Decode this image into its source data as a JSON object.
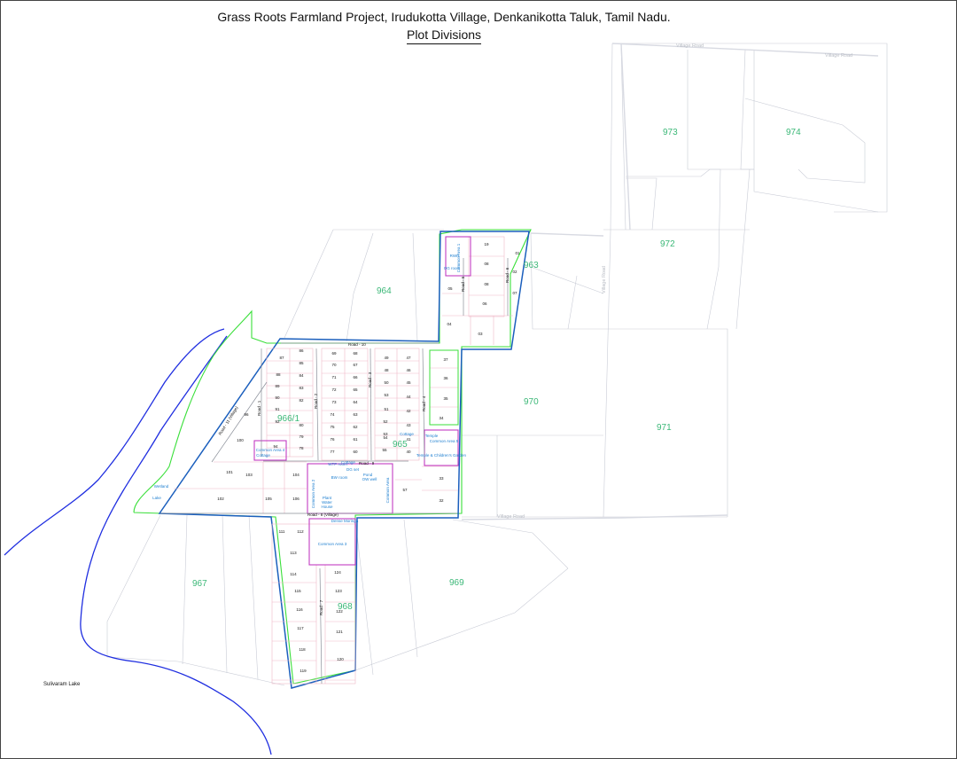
{
  "title": {
    "line1": "Grass Roots Farmland Project, Irudukotta Village, Denkanikotta Taluk, Tamil Nadu.",
    "line2": "Plot Divisions"
  },
  "colors": {
    "survey_label": "#3cb878",
    "project_boundary": "#1b5fbd",
    "outer_boundary": "#3adf3a",
    "common_area": "#c23cc2",
    "plot_lines": "#f0b8c8",
    "lake_shore": "#1f2ee0",
    "survey_lines": "#c9ccd6"
  },
  "survey_numbers": [
    "973",
    "974",
    "972",
    "963",
    "964",
    "966/1",
    "965",
    "970",
    "971",
    "967",
    "968",
    "969"
  ],
  "roads": {
    "road_10": "Road - 10",
    "road_9": "Road - 9",
    "road_8": "Road - 8 (Village)",
    "road_1": "Road - 1",
    "road_2": "Road - 2",
    "road_3": "Road - 3",
    "road_4": "Road - 4",
    "road_5": "Road - 5",
    "road_6": "Road - 6",
    "road_7": "Road - 7",
    "road_11": "Road - 11 (Village)",
    "village_road_top": "Village Road",
    "village_road_top2": "Village Road",
    "village_road_east": "Village Road",
    "village_road_mid": "Village Road"
  },
  "common_areas": {
    "ca1": "Common Area 1",
    "ca2": "Common Area 2",
    "ca3": "Common Area 3",
    "ca4": "Common Area 4",
    "ca5": "Common Area 5",
    "ca_label": "Common Area",
    "og_room": "OG room",
    "rwr": "RWR",
    "temple": "Temple",
    "cottage1": "Cottage",
    "cottage2": "Cottage",
    "cottage3": "Cottage",
    "temple_garden": "Temple & Children's Garden",
    "dg_set": "DG set",
    "pond": "Pond",
    "ow_well": "OW well",
    "wtp": "WTP room",
    "bw": "BW room",
    "wetland": "Wetland",
    "plant": "Plant",
    "water": "Water",
    "house": "House",
    "lake_label": "Lake",
    "dense_moringa": "Dense Moringa"
  },
  "lake": "Sulivaram Lake",
  "plots": {
    "top_block": [
      "19",
      "01",
      "08",
      "02",
      "08",
      "07",
      "06",
      "05",
      "04",
      "03"
    ],
    "col_a": [
      "87",
      "88",
      "89",
      "90",
      "91",
      "92",
      "96",
      "100",
      "94",
      "101",
      "102",
      "103",
      "105"
    ],
    "col_b": [
      "86",
      "85",
      "84",
      "83",
      "82",
      "80",
      "79",
      "78",
      "104",
      "106"
    ],
    "col_c": [
      "69",
      "70",
      "71",
      "72",
      "73",
      "74",
      "75",
      "76",
      "77"
    ],
    "col_d": [
      "68",
      "67",
      "66",
      "65",
      "64",
      "63",
      "62",
      "61",
      "60"
    ],
    "col_e": [
      "49",
      "48",
      "50",
      "53",
      "51",
      "52",
      "53",
      "54",
      "55"
    ],
    "col_f": [
      "47",
      "46",
      "45",
      "44",
      "42",
      "43",
      "41",
      "40"
    ],
    "col_g": [
      "37",
      "36",
      "35",
      "34"
    ],
    "col_h": [
      "57",
      "33",
      "32"
    ],
    "south_a": [
      "111",
      "113",
      "114",
      "115",
      "116",
      "117",
      "118",
      "119"
    ],
    "south_b": [
      "112",
      "124",
      "123",
      "122",
      "121",
      "120"
    ]
  }
}
